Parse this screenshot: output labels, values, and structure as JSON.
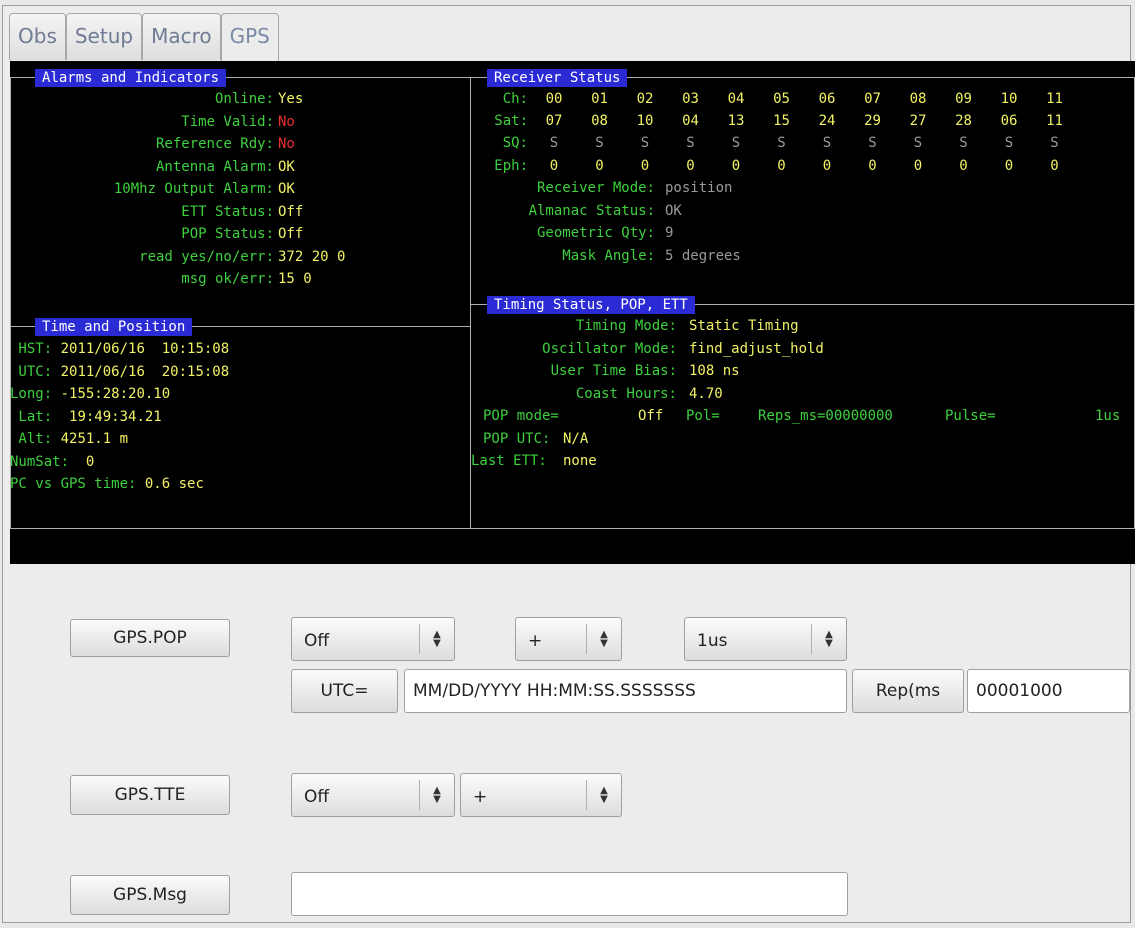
{
  "tabs": [
    "Obs",
    "Setup",
    "Macro",
    "GPS"
  ],
  "alarms": {
    "title": "Alarms and Indicators",
    "rows": [
      {
        "label": "Online:",
        "value": "Yes",
        "status": "ok"
      },
      {
        "label": "Time Valid:",
        "value": "No",
        "status": "bad"
      },
      {
        "label": "Reference Rdy:",
        "value": "No",
        "status": "bad"
      },
      {
        "label": "Antenna Alarm:",
        "value": "OK",
        "status": "ok"
      },
      {
        "label": "10Mhz Output Alarm:",
        "value": "OK",
        "status": "ok"
      },
      {
        "label": "ETT Status:",
        "value": "Off",
        "status": "ok"
      },
      {
        "label": "POP Status:",
        "value": "Off",
        "status": "ok"
      },
      {
        "label": "read yes/no/err:",
        "value": "372 20 0",
        "status": "ok"
      },
      {
        "label": "msg ok/err:",
        "value": "15 0",
        "status": "ok"
      }
    ]
  },
  "time_position": {
    "title": "Time and Position",
    "rows": [
      {
        "label": " HST:",
        "value": " 2011/06/16  10:15:08"
      },
      {
        "label": " UTC:",
        "value": " 2011/06/16  20:15:08"
      },
      {
        "label": "Long:",
        "value": " -155:28:20.10"
      },
      {
        "label": " Lat:",
        "value": "  19:49:34.21"
      },
      {
        "label": " Alt:",
        "value": " 4251.1 m"
      },
      {
        "label": "NumSat:",
        "value": "  0"
      },
      {
        "label": "PC vs GPS time:",
        "value": " 0.6 sec"
      }
    ]
  },
  "receiver": {
    "title": "Receiver Status",
    "ch_label": "Ch:",
    "sat_label": "Sat:",
    "sq_label": "SQ:",
    "eph_label": "Eph:",
    "ch": [
      "00",
      "01",
      "02",
      "03",
      "04",
      "05",
      "06",
      "07",
      "08",
      "09",
      "10",
      "11"
    ],
    "sat": [
      "07",
      "08",
      "10",
      "04",
      "13",
      "15",
      "24",
      "29",
      "27",
      "28",
      "06",
      "11"
    ],
    "sq": [
      "S",
      "S",
      "S",
      "S",
      "S",
      "S",
      "S",
      "S",
      "S",
      "S",
      "S",
      "S"
    ],
    "eph": [
      "0",
      "0",
      "0",
      "0",
      "0",
      "0",
      "0",
      "0",
      "0",
      "0",
      "0",
      "0"
    ],
    "fields": [
      {
        "label": "Receiver Mode:",
        "value": "position"
      },
      {
        "label": "Almanac Status:",
        "value": "OK"
      },
      {
        "label": "Geometric Qty:",
        "value": "9"
      },
      {
        "label": "Mask Angle:",
        "value": "5 degrees"
      }
    ]
  },
  "timing": {
    "title": "Timing Status, POP, ETT",
    "rows": [
      {
        "label": "Timing Mode:",
        "value": "Static Timing"
      },
      {
        "label": "Oscillator Mode:",
        "value": "find_adjust_hold"
      },
      {
        "label": "User Time Bias:",
        "value": "108 ns"
      },
      {
        "label": "Coast Hours:",
        "value": "4.70"
      }
    ],
    "pop_line": {
      "pop_mode_label": "POP mode=",
      "pop_mode_value": "Off",
      "pol_label": "Pol=",
      "reps_label": "Reps_ms=00000000",
      "pulse_label": "Pulse=",
      "pulse_value": "1us"
    },
    "pop_utc": {
      "label": "POP UTC:",
      "value": "N/A"
    },
    "last_ett": {
      "label": "Last ETT:",
      "value": "none"
    }
  },
  "controls": {
    "pop_button": "GPS.POP",
    "pop_mode_select": "Off",
    "pop_pol_select": "+",
    "pop_pulse_select": "1us",
    "utc_button": "UTC=",
    "utc_input_value": "MM/DD/YYYY HH:MM:SS.SSSSSSS",
    "rep_button": "Rep(ms",
    "rep_input_value": "00001000",
    "tte_button": "GPS.TTE",
    "tte_mode_select": "Off",
    "tte_pol_select": "+",
    "msg_button": "GPS.Msg",
    "msg_input_value": ""
  }
}
